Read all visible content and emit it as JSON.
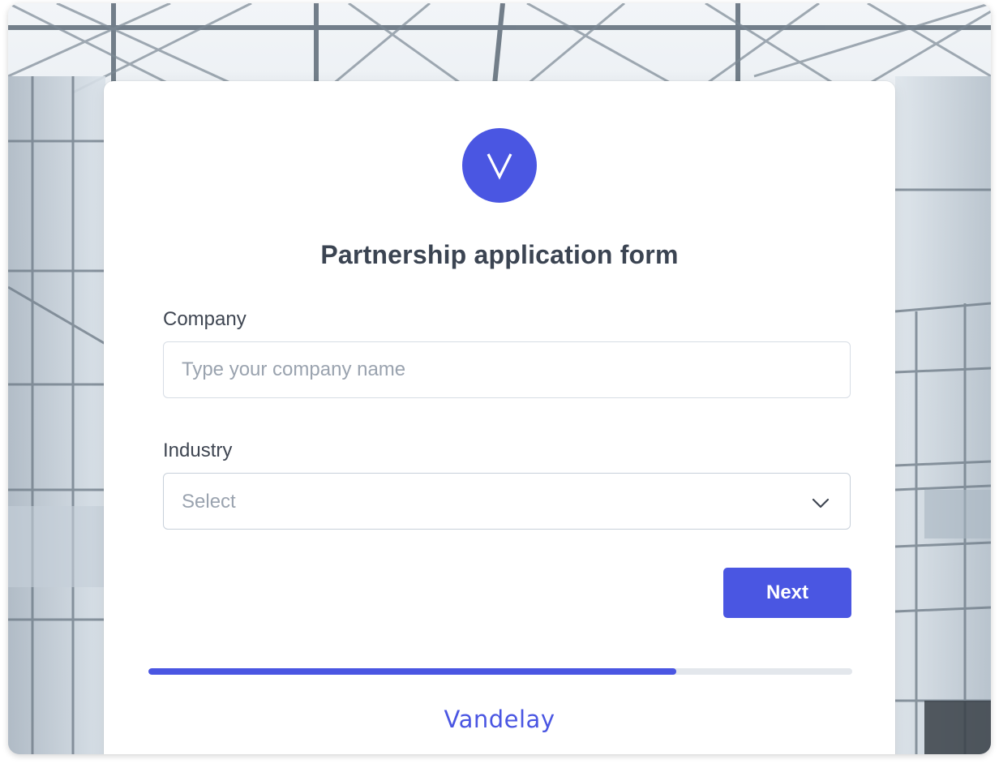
{
  "form": {
    "logo_letter": "V",
    "title": "Partnership application form",
    "company": {
      "label": "Company",
      "placeholder": "Type your company name",
      "value": ""
    },
    "industry": {
      "label": "Industry",
      "selected": "Select"
    },
    "next_label": "Next",
    "progress_percent": 75
  },
  "brand": {
    "name": "Vandelay"
  },
  "colors": {
    "accent": "#4a56e2",
    "title_text": "#3b4452",
    "placeholder": "#9aa3af",
    "progress_track": "#e3e7ec"
  },
  "icons": {
    "select_chevron": "chevron-down-icon"
  }
}
